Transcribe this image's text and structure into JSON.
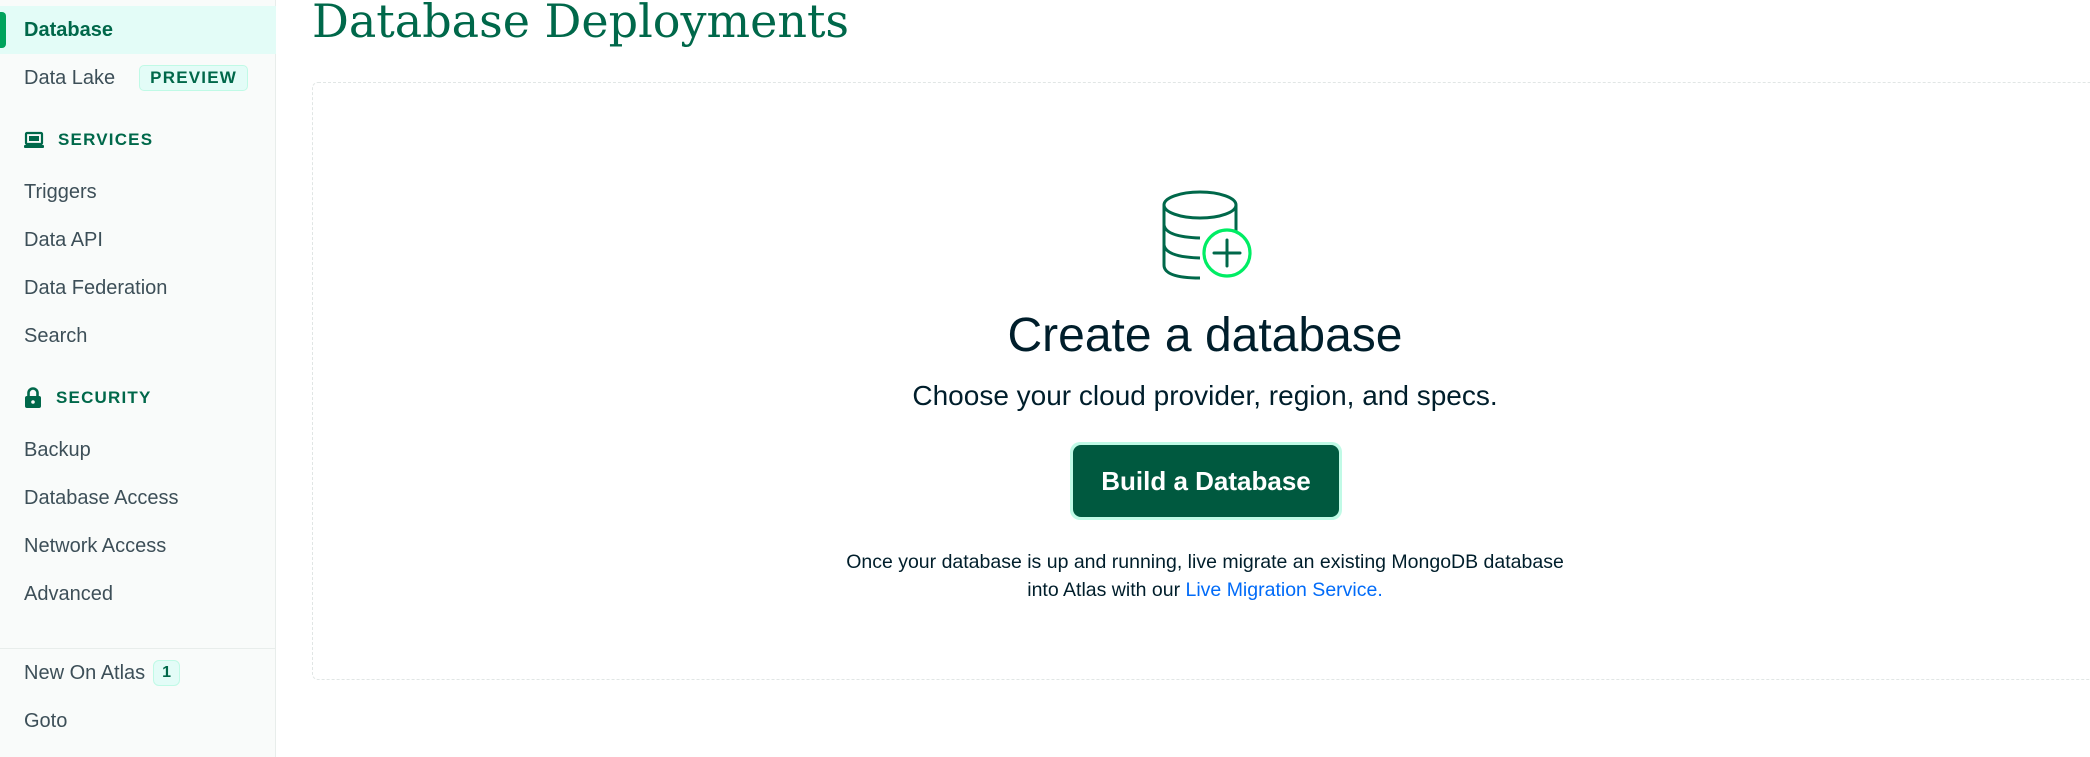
{
  "sidebar": {
    "items": [
      {
        "label": "Database",
        "active": true
      },
      {
        "label": "Data Lake",
        "badge": "PREVIEW"
      }
    ],
    "services": {
      "heading": "SERVICES",
      "icon": "laptop-icon",
      "items": [
        "Triggers",
        "Data API",
        "Data Federation",
        "Search"
      ]
    },
    "security": {
      "heading": "SECURITY",
      "icon": "lock-icon",
      "items": [
        "Backup",
        "Database Access",
        "Network Access",
        "Advanced"
      ]
    },
    "footer": {
      "new_on_atlas": "New On Atlas",
      "new_on_atlas_count": "1",
      "goto": "Goto"
    }
  },
  "main": {
    "title": "Database Deployments",
    "empty_state": {
      "icon": "database-plus-icon",
      "headline": "Create a database",
      "subline": "Choose your cloud provider, region, and specs.",
      "cta_label": "Build a Database",
      "footnote_line1": "Once your database is up and running, live migrate an existing MongoDB database",
      "footnote_line2_prefix": "into Atlas with our",
      "footnote_link": "Live Migration Service."
    }
  },
  "colors": {
    "brand_dark_green": "#00684a",
    "accent_green": "#00ed64",
    "cta_background": "#00593f",
    "link_blue": "#016bf8"
  }
}
